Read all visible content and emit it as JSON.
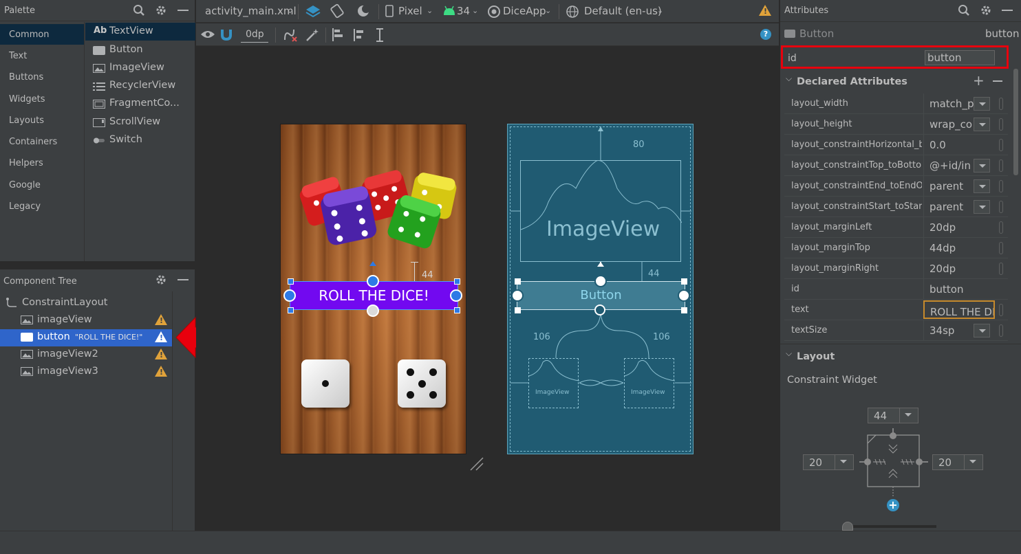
{
  "palette": {
    "title": "Palette",
    "categories": [
      "Common",
      "Text",
      "Buttons",
      "Widgets",
      "Layouts",
      "Containers",
      "Helpers",
      "Google",
      "Legacy"
    ],
    "items": [
      "TextView",
      "Button",
      "ImageView",
      "RecyclerView",
      "FragmentCo...",
      "ScrollView",
      "Switch"
    ],
    "textview_glyph": "Ab"
  },
  "tree": {
    "title": "Component Tree",
    "root": "ConstraintLayout",
    "items": [
      {
        "name": "imageView",
        "detail": ""
      },
      {
        "name": "button",
        "detail": "\"ROLL THE DICE!\""
      },
      {
        "name": "imageView2",
        "detail": ""
      },
      {
        "name": "imageView3",
        "detail": ""
      }
    ]
  },
  "toolbar": {
    "file": "activity_main.xml",
    "device": "Pixel",
    "api": "34",
    "app": "DiceApp",
    "locale": "Default (en-us)",
    "margin": "0dp"
  },
  "design": {
    "button_text": "ROLL THE DICE!",
    "margin_label": "44"
  },
  "blueprint": {
    "imageview_label": "ImageView",
    "button_label": "Button",
    "top_margin": "80",
    "button_margin": "44",
    "left_margin": "106",
    "right_margin": "106",
    "small_image_label": "ImageView"
  },
  "attributes": {
    "title": "Attributes",
    "widget_type": "Button",
    "widget_id": "button",
    "id_label": "id",
    "id_value": "button",
    "declared_title": "Declared Attributes",
    "rows": [
      {
        "name": "layout_width",
        "value": "match_p"
      },
      {
        "name": "layout_height",
        "value": "wrap_co"
      },
      {
        "name": "layout_constraintHorizontal_bi...",
        "value": "0.0"
      },
      {
        "name": "layout_constraintTop_toBotto...",
        "value": "@+id/in"
      },
      {
        "name": "layout_constraintEnd_toEndOf",
        "value": "parent"
      },
      {
        "name": "layout_constraintStart_toStart...",
        "value": "parent"
      },
      {
        "name": "layout_marginLeft",
        "value": "20dp"
      },
      {
        "name": "layout_marginTop",
        "value": "44dp"
      },
      {
        "name": "layout_marginRight",
        "value": "20dp"
      },
      {
        "name": "id",
        "value": "button"
      },
      {
        "name": "text",
        "value": "ROLL THE DIC"
      },
      {
        "name": "textSize",
        "value": "34sp"
      }
    ],
    "layout_title": "Layout",
    "constraint_widget": "Constraint Widget",
    "cw_top": "44",
    "cw_left": "20",
    "cw_right": "20"
  },
  "colors": {
    "selection": "#2f65ca",
    "button_purple": "#7209f0",
    "blueprint_bg": "#205b72",
    "highlight": "#e8000d",
    "warning": "#e0a23a"
  }
}
